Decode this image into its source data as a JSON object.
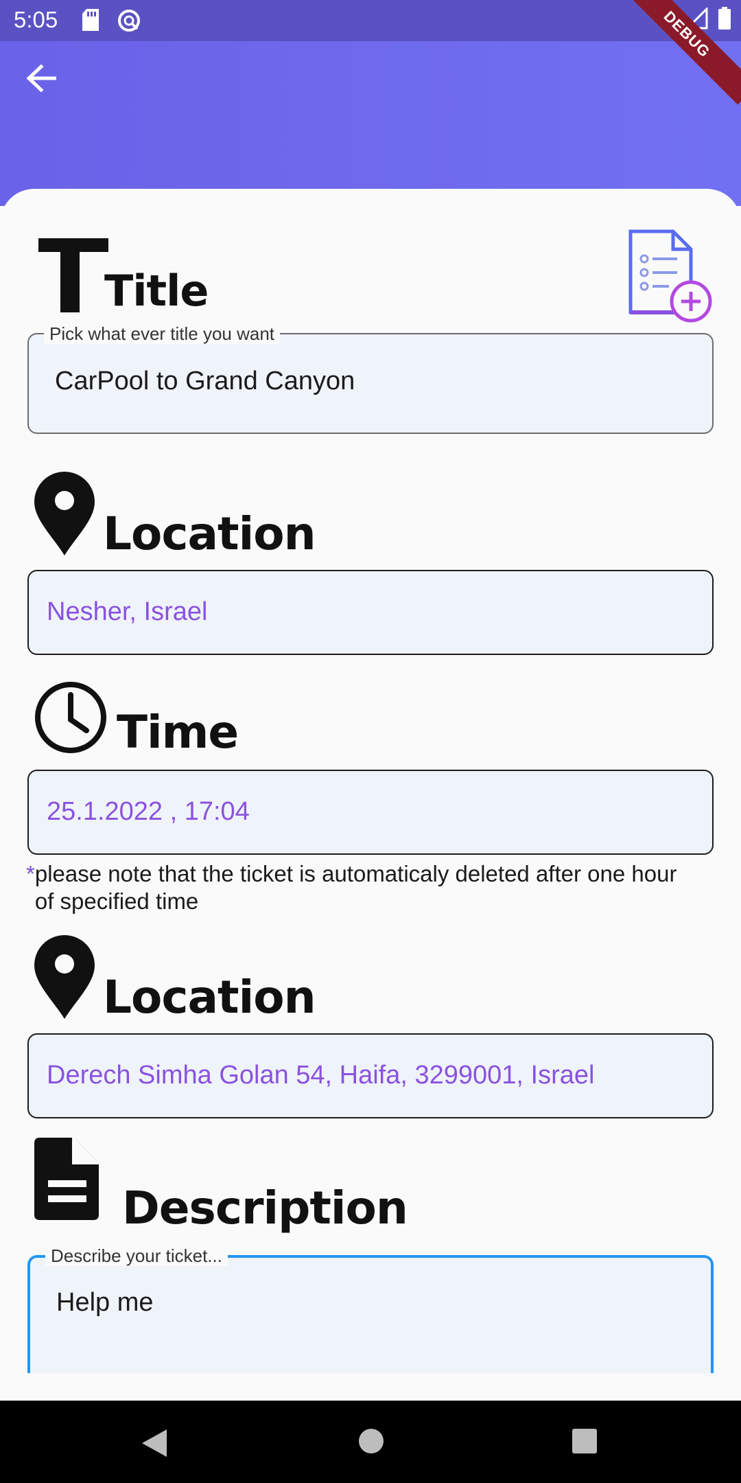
{
  "status_bar": {
    "time": "5:05",
    "debug_label": "DEBUG"
  },
  "header": {
    "back_icon": "arrow-back-icon"
  },
  "title_section": {
    "label": "Title",
    "field_label": "Pick what ever title you want",
    "value": "CarPool to Grand Canyon"
  },
  "location_from": {
    "label": "Location",
    "value": "Nesher, Israel"
  },
  "time_section": {
    "label": "Time",
    "value": "25.1.2022 , 17:04",
    "note_star": "*",
    "note": "please note that the ticket is automaticaly deleted after one hour of specified time"
  },
  "location_to": {
    "label": "Location",
    "value": "Derech Simha Golan 54, Haifa, 3299001, Israel"
  },
  "description_section": {
    "label": "Description",
    "field_label": "Describe your ticket...",
    "value": "Help me"
  },
  "colors": {
    "header": "#6c66ec",
    "accent_text": "#8a52e0",
    "focus_border": "#2196f3",
    "debug_ribbon": "#8a1a2a"
  }
}
